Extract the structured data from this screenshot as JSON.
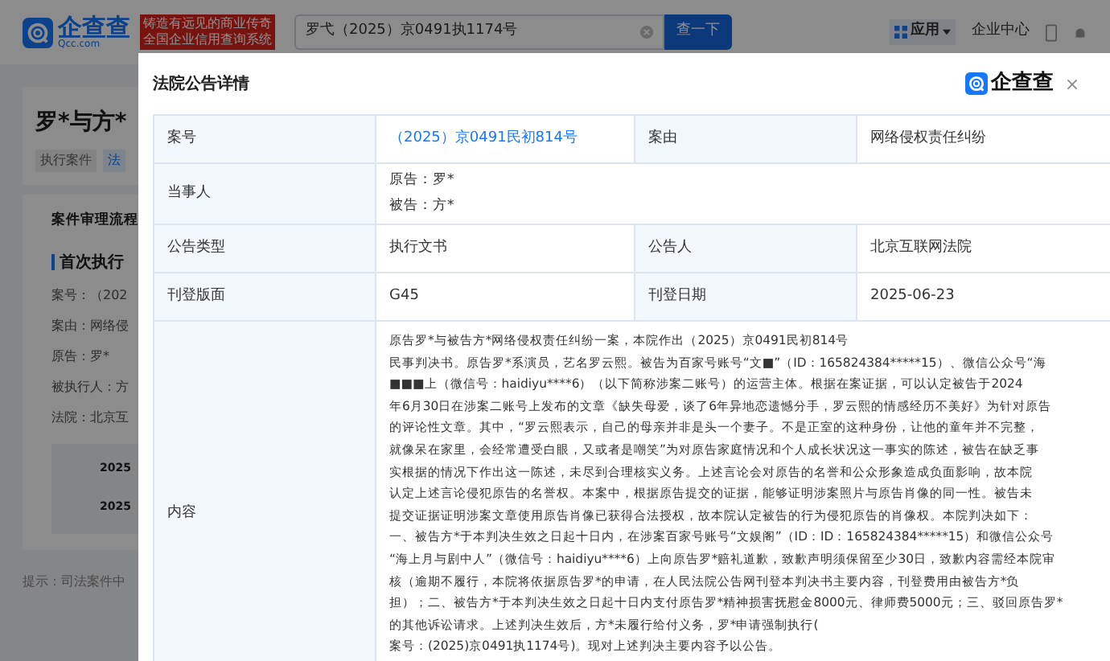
{
  "topbar": {
    "logo_text": "企查查",
    "logo_sub": "Qcc.com",
    "slogan": [
      "铸造有远见的商业传奇",
      "全国企业信用查询系统"
    ],
    "search": {
      "value": "罗弋（2025）京0491执1174号"
    },
    "search_button": "查一下",
    "apps_button": "应用",
    "enterprise_center": "企业中心"
  },
  "background_card": {
    "title": "罗*与方*",
    "tags": [
      "执行案件",
      "法"
    ],
    "process_title": "案件审理流程",
    "section": "首次执行",
    "fields": [
      "案号：（202",
      "案由：网络侵",
      "原告：罗*",
      "被执行人：方",
      "法院：北京互"
    ],
    "dates": [
      "2025",
      "2025"
    ],
    "hint": "提示：司法案件中"
  },
  "modal": {
    "title": "法院公告详情",
    "logo_text": "企查查",
    "rows": [
      {
        "kind": "pair",
        "label": "案号",
        "value": "（2025）京0491民初814号",
        "link": true,
        "label2": "案由",
        "value2": "网络侵权责任纠纷"
      },
      {
        "kind": "lines",
        "label": "当事人",
        "lines": [
          "原告：罗*",
          "被告：方*"
        ]
      },
      {
        "kind": "pair",
        "label": "公告类型",
        "value": "执行文书",
        "link": false,
        "label2": "公告人",
        "value2": "北京互联网法院"
      },
      {
        "kind": "pair",
        "label": "刊登版面",
        "value": "G45",
        "link": false,
        "label2": "刊登日期",
        "value2": "2025-06-23"
      },
      {
        "kind": "content",
        "label": "内容",
        "lines": [
          "原告罗*与被告方*网络侵权责任纠纷一案，本院作出（2025）京0491民初814号",
          "民事判决书。原告罗*系演员，艺名罗云熙。被告为百家号账号“文■”（ID：165824384*****15）、微信公众号“海",
          "■■■上（微信号：haidiyu****6）（以下简称涉案二账号）的运营主体。根据在案证据，可以认定被告于2024",
          "年6月30日在涉案二账号上发布的文章《缺失母爱，谈了6年异地恋遗憾分手，罗云熙的情感经历不美好》为针对原告",
          "的评论性文章。其中，“罗云熙表示，自己的母亲并非是头一个妻子。不是正室的这种身份，让他的童年并不完整，",
          "就像呆在家里，会经常遭受白眼，又或者是嘲笑”为对原告家庭情况和个人成长状况这一事实的陈述，被告在缺乏事",
          "实根据的情况下作出这一陈述，未尽到合理核实义务。上述言论会对原告的名誉和公众形象造成负面影响，故本院",
          "认定上述言论侵犯原告的名誉权。本案中，根据原告提交的证据，能够证明涉案照片与原告肖像的同一性。被告未",
          "提交证据证明涉案文章使用原告肖像已获得合法授权，故本院认定被告的行为侵犯原告的肖像权。本院判决如下：",
          "一、被告方*于本判决生效之日起十日内，在涉案百家号账号“文娱阁”（ID：ID：165824384*****15）和微信公众号",
          "“海上月与剧中人”（微信号：haidiyu****6）上向原告罗*赔礼道歉，致歉声明须保留至少30日，致歉内容需经本院审",
          "核（逾期不履行，本院将依据原告罗*的申请，在人民法院公告网刊登本判决书主要内容，刊登费用由被告方*负",
          "担）；二、被告方*于本判决生效之日起十日内支付原告罗*精神损害抚慰金8000元、律师费5000元；三、驳回原告罗*",
          "的其他诉讼请求。上述判决生效后，方*未履行给付义务，罗*申请强制执行(",
          "案号：(2025)京0491执1174号)。现对上述判决主要内容予以公告。"
        ]
      }
    ]
  }
}
